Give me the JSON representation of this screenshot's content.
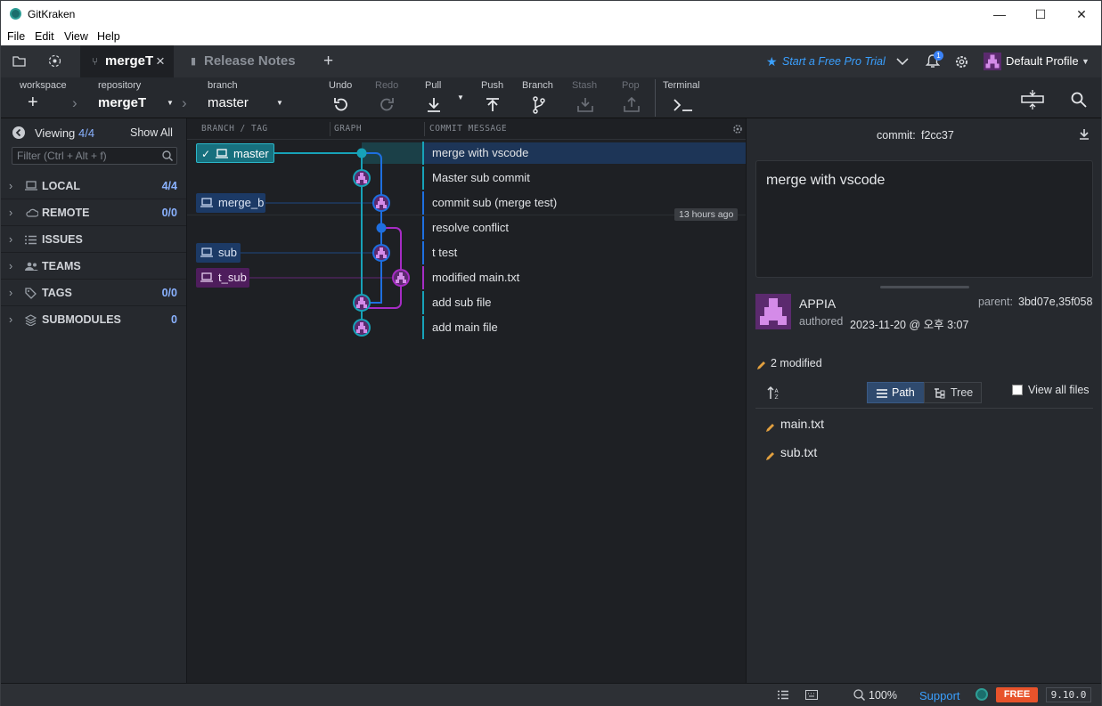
{
  "window": {
    "title": "GitKraken",
    "minimize": "—",
    "maximize": "☐",
    "close": "✕"
  },
  "menu": [
    "File",
    "Edit",
    "View",
    "Help"
  ],
  "tabs": {
    "active": "mergeT",
    "close": "×",
    "second": "Release Notes",
    "add": "+"
  },
  "header": {
    "trial": "Start a Free Pro Trial",
    "notif_count": "1",
    "profile": "Default Profile"
  },
  "toolbar": {
    "workspace_label": "workspace",
    "repository_label": "repository",
    "repository": "mergeT",
    "branch_label": "branch",
    "branch": "master",
    "undo": "Undo",
    "redo": "Redo",
    "pull": "Pull",
    "push": "Push",
    "branch_btn": "Branch",
    "stash": "Stash",
    "pop": "Pop",
    "terminal": "Terminal"
  },
  "sidebar": {
    "viewing_label": "Viewing",
    "viewing_count": "4/4",
    "show_all": "Show All",
    "filter_placeholder": "Filter (Ctrl + Alt + f)",
    "sections": [
      {
        "label": "LOCAL",
        "count": "4/4",
        "icon": "laptop-icon"
      },
      {
        "label": "REMOTE",
        "count": "0/0",
        "icon": "cloud-icon"
      },
      {
        "label": "ISSUES",
        "count": "",
        "icon": "list-icon"
      },
      {
        "label": "TEAMS",
        "count": "",
        "icon": "people-icon"
      },
      {
        "label": "TAGS",
        "count": "0/0",
        "icon": "tag-icon"
      },
      {
        "label": "SUBMODULES",
        "count": "0",
        "icon": "layers-icon"
      }
    ]
  },
  "graph": {
    "col_branch": "BRANCH / TAG",
    "col_graph": "GRAPH",
    "col_message": "COMMIT MESSAGE",
    "branches": {
      "master": "master",
      "merge_b": "merge_b",
      "sub": "sub",
      "t_sub": "t_sub"
    },
    "commits": [
      "merge with vscode",
      "Master sub commit",
      "commit sub (merge test)",
      "resolve conflict",
      "t test",
      "modified main.txt",
      "add sub file",
      "add main file"
    ],
    "time_hint": "13 hours ago",
    "colors": {
      "master": "#17a2b8",
      "merge_b": "#1e6fe0",
      "t_sub": "#a62cc4"
    }
  },
  "detail": {
    "commit_label": "commit:",
    "commit_sha": "f2cc37",
    "message": "merge with vscode",
    "author": "APPIA",
    "authored_label": "authored",
    "authored_date": "2023-11-20 @ 오후 3:07",
    "parent_label": "parent:",
    "parent_value": "3bd07e,35f058",
    "modified": "2 modified",
    "path_btn": "Path",
    "tree_btn": "Tree",
    "view_all": "View all files",
    "files": [
      "main.txt",
      "sub.txt"
    ]
  },
  "status": {
    "zoom": "100%",
    "support": "Support",
    "plan": "FREE",
    "version": "9.10.0"
  }
}
